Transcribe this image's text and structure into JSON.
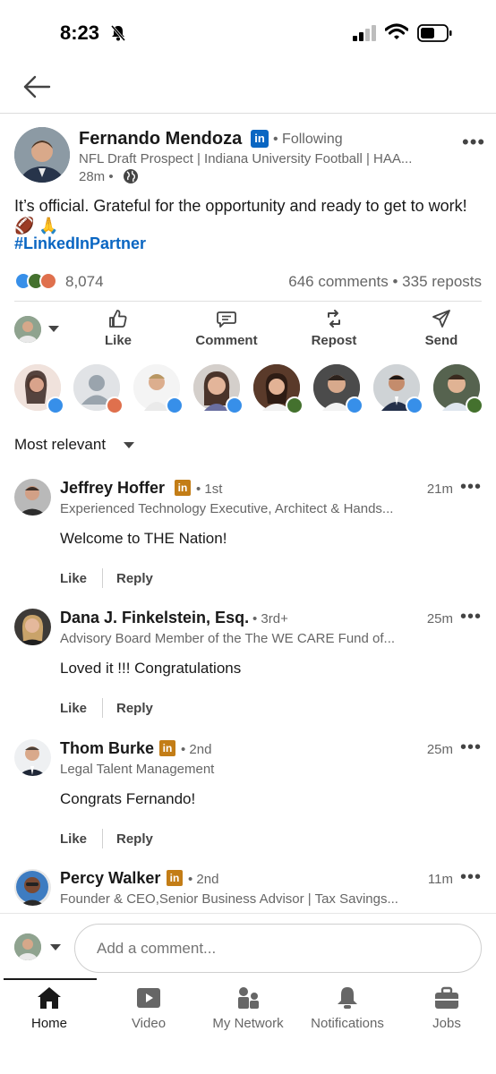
{
  "status_bar": {
    "time": "8:23"
  },
  "post": {
    "author_name": "Fernando Mendoza",
    "author_badge": "in",
    "following": "• Following",
    "headline": "NFL Draft Prospect | Indiana University Football | HAA...",
    "time_ago": "28m •",
    "text": "It’s official. Grateful for the opportunity and ready to get to work! 🏈 🙏",
    "hashtag": "#LinkedInPartner",
    "reaction_count": "8,074",
    "comments_reposts": "646 comments • 335 reposts"
  },
  "actions": {
    "like": "Like",
    "comment": "Comment",
    "repost": "Repost",
    "send": "Send"
  },
  "sort_label": "Most relevant",
  "comments": [
    {
      "name": "Jeffrey Hoffer",
      "badge": "in",
      "degree": "• 1st",
      "time": "21m",
      "headline": "Experienced Technology Executive, Architect & Hands...",
      "text": "Welcome to THE Nation!",
      "like": "Like",
      "reply": "Reply"
    },
    {
      "name": "Dana J. Finkelstein, Esq.",
      "badge": "",
      "degree": "• 3rd+",
      "time": "25m",
      "headline": "Advisory Board Member of the The WE CARE Fund of...",
      "text": "Loved it !!! Congratulations",
      "like": "Like",
      "reply": "Reply"
    },
    {
      "name": "Thom Burke",
      "badge": "in",
      "degree": "• 2nd",
      "time": "25m",
      "headline": "Legal Talent Management",
      "text": "Congrats Fernando!",
      "like": "Like",
      "reply": "Reply"
    },
    {
      "name": "Percy Walker",
      "badge": "in",
      "degree": "• 2nd",
      "time": "11m",
      "headline": "Founder & CEO,Senior Business Advisor | Tax Savings...",
      "text": "",
      "like": "",
      "reply": ""
    }
  ],
  "composer": {
    "placeholder": "Add a comment..."
  },
  "bottom_nav": {
    "home": "Home",
    "video": "Video",
    "network": "My Network",
    "notifications": "Notifications",
    "jobs": "Jobs"
  },
  "colors": {
    "linkedin_blue": "#0a66c2",
    "premium_gold": "#c37d16",
    "text_primary": "#191919",
    "text_secondary": "#666666"
  },
  "icons": [
    "back-arrow-icon",
    "globe-icon",
    "more-icon",
    "like-icon",
    "comment-icon",
    "repost-icon",
    "send-icon",
    "home-icon",
    "video-icon",
    "network-icon",
    "bell-icon",
    "briefcase-icon"
  ]
}
